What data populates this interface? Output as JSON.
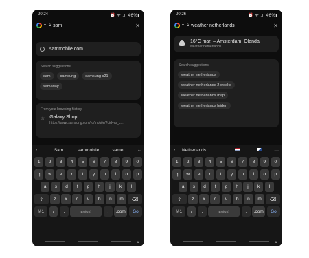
{
  "phone1": {
    "time": "20:24",
    "status_right": "⏰ ᯤ .ıl 46%▮",
    "query": "sam",
    "url_suggestion": "sammobile.com",
    "suggestions_title": "Search suggestions",
    "suggestions": [
      "sam",
      "samsung",
      "samsung s21",
      "sameday"
    ],
    "history_title": "From your browsing history",
    "history_item_title": "Galaxy Shop",
    "history_item_url": "https://www.samsung.com/ro/mobile/?cid=ro_c...",
    "keyboard_suggestions": [
      "Sam",
      "sammobile",
      "same"
    ],
    "language": "EN(US)"
  },
  "phone2": {
    "time": "20:26",
    "status_right": "⏰ ᯤ .ıl 46%▮",
    "query": "weather netherlands",
    "weather_title": "16°C mar. – Amsterdam, Olanda",
    "weather_sub": "weather netherlands",
    "suggestions_title": "Search suggestions",
    "suggestions": [
      "weather netherlands",
      "weather netherlands 2 weeks",
      "weather netherlands map",
      "weather netherlands leiden"
    ],
    "keyboard_suggestions": [
      "Netherlands"
    ],
    "language": "EN(US)"
  },
  "keyboard": {
    "row1": [
      "1",
      "2",
      "3",
      "4",
      "5",
      "6",
      "7",
      "8",
      "9",
      "0"
    ],
    "row2": [
      "q",
      "w",
      "e",
      "r",
      "t",
      "y",
      "u",
      "i",
      "o",
      "p"
    ],
    "row3": [
      "a",
      "s",
      "d",
      "f",
      "g",
      "h",
      "j",
      "k",
      "l"
    ],
    "row4": [
      "z",
      "x",
      "c",
      "v",
      "b",
      "n",
      "m"
    ],
    "sym_key": "!#1",
    "slash": "/",
    "comma": ",",
    "period": ".",
    "com": ".com",
    "go": "Go"
  },
  "colors": {
    "screen_bg": "#0d0d0d",
    "card_bg": "#1f1f1f",
    "chip_bg": "#2e2e2e",
    "key_bg": "#3a3a3a"
  }
}
